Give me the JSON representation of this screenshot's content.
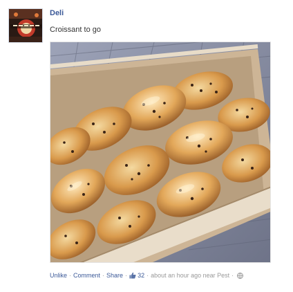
{
  "post": {
    "author": "Deli",
    "message": "Croissant to go",
    "photo": {
      "icon": "photo-croissants-in-box",
      "colors": {
        "box": "#d6c2a6",
        "pastry": "#c9893f",
        "chocolate": "#3b2416",
        "pavement": "#8a8fa3"
      }
    },
    "footer": {
      "unlike": "Unlike",
      "comment": "Comment",
      "share": "Share",
      "separator": "·",
      "like_icon": "thumbs-up-icon",
      "like_count": "32",
      "time_location": "about an hour ago near Pest",
      "privacy_icon": "globe-icon"
    }
  },
  "theme": {
    "link_color": "#3b5998",
    "meta_color": "#999999",
    "text_color": "#333333"
  }
}
